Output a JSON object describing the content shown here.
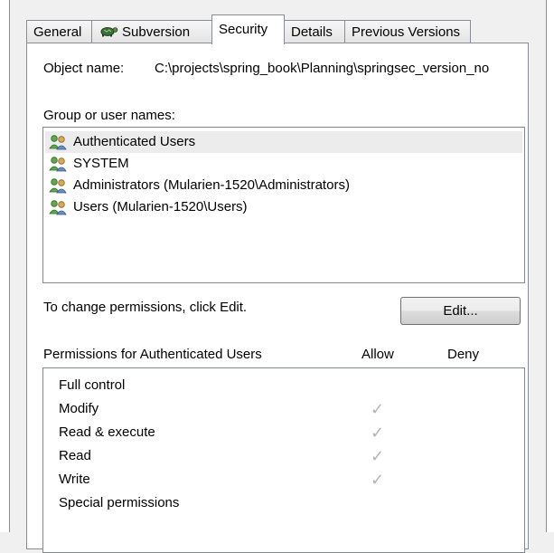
{
  "tabs": [
    {
      "label": "General"
    },
    {
      "label": "Subversion"
    },
    {
      "label": "Security"
    },
    {
      "label": "Details"
    },
    {
      "label": "Previous Versions"
    }
  ],
  "object": {
    "label": "Object name:",
    "value": "C:\\projects\\spring_book\\Planning\\springsec_version_no"
  },
  "groups": {
    "label": "Group or user names:",
    "items": [
      {
        "name": "Authenticated Users",
        "selected": true
      },
      {
        "name": "SYSTEM"
      },
      {
        "name": "Administrators (Mularien-1520\\Administrators)"
      },
      {
        "name": "Users (Mularien-1520\\Users)"
      }
    ]
  },
  "change_hint": "To change permissions, click Edit.",
  "edit_button": "Edit...",
  "permissions": {
    "header": "Permissions for Authenticated Users",
    "allow_header": "Allow",
    "deny_header": "Deny",
    "check_glyph": "✓",
    "rows": [
      {
        "label": "Full control",
        "allow": false,
        "deny": false
      },
      {
        "label": "Modify",
        "allow": true,
        "deny": false
      },
      {
        "label": "Read & execute",
        "allow": true,
        "deny": false
      },
      {
        "label": "Read",
        "allow": true,
        "deny": false
      },
      {
        "label": "Write",
        "allow": true,
        "deny": false
      },
      {
        "label": "Special permissions",
        "allow": false,
        "deny": false
      }
    ]
  },
  "colors": {
    "accent": "#3d7ed6",
    "check": "#b4b4b4",
    "selection": "#ececec"
  }
}
